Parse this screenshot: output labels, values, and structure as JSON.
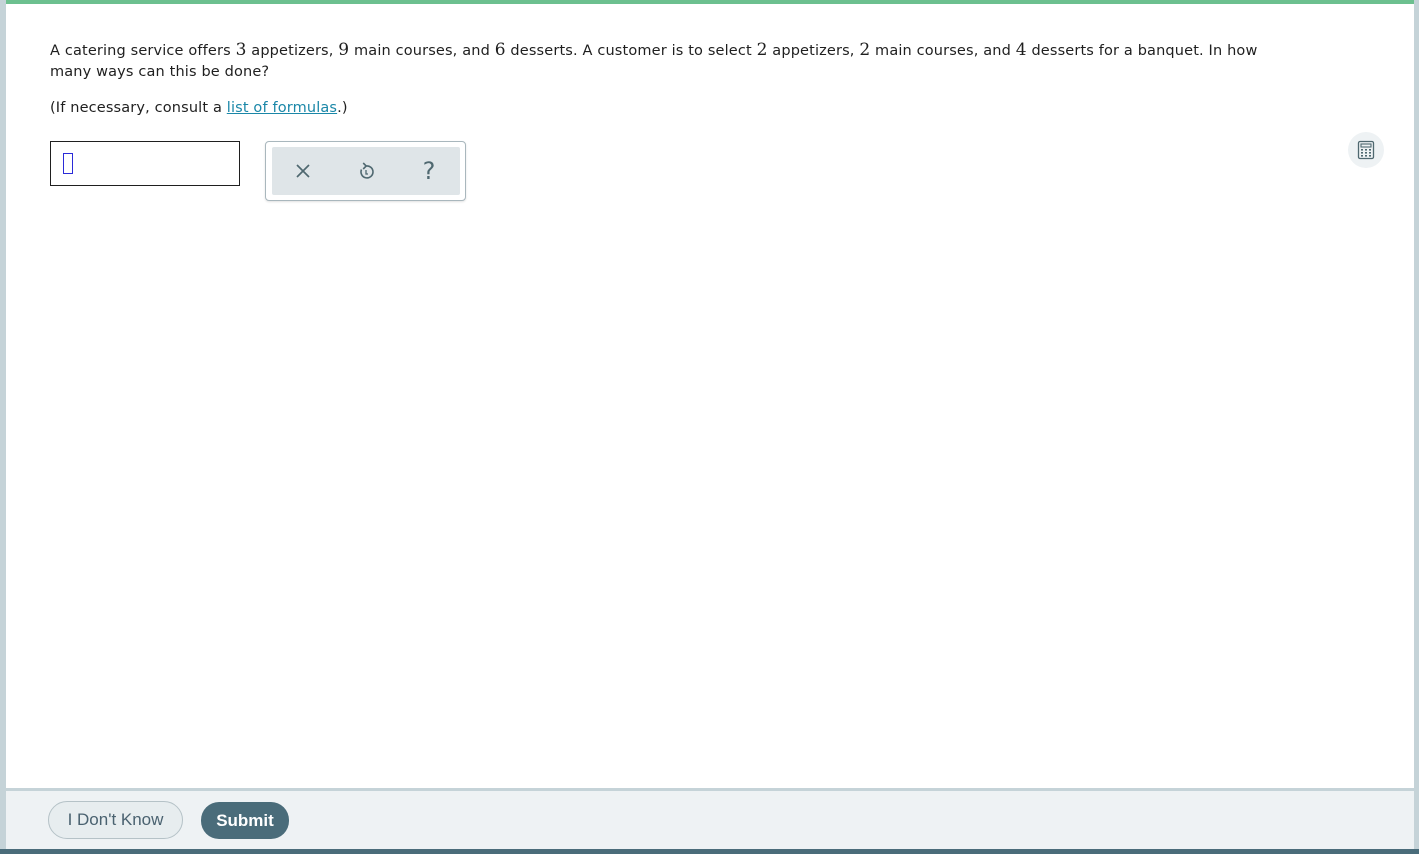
{
  "question": {
    "t1": "A catering service offers ",
    "n1": "3",
    "t2": " appetizers, ",
    "n2": "9",
    "t3": " main courses, and ",
    "n3": "6",
    "t4": " desserts. A customer is to select ",
    "n4": "2",
    "t5": " appetizers, ",
    "n5": "2",
    "t6": " main courses, and ",
    "n6": "4",
    "t7": " desserts for a banquet. In how many ways can this be done?"
  },
  "formula": {
    "prefix": "(If necessary, consult a ",
    "link_text": "list of formulas",
    "suffix": ".)"
  },
  "answer": {
    "value": ""
  },
  "tools": {
    "clear_icon": "close-icon",
    "undo_icon": "undo-icon",
    "help_icon": "help-icon",
    "help_glyph": "?"
  },
  "footer": {
    "dont_know_label": "I Don't Know",
    "submit_label": "Submit"
  },
  "colors": {
    "accent_green": "#6cc08f",
    "link": "#1a87a8",
    "submit_bg": "#4a6c7a",
    "caret": "#2b2bd8"
  }
}
